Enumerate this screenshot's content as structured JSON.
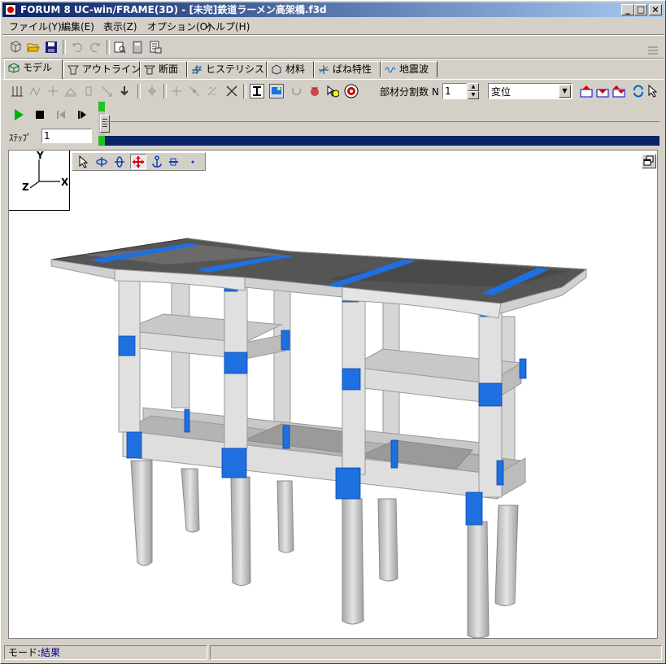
{
  "window": {
    "title": "FORUM 8  UC-win/FRAME(3D) - [未完]鉄道ラーメン高架橋.f3d",
    "controls": [
      "_",
      "□",
      "×"
    ]
  },
  "menu": [
    "ファイル(Y)",
    "編集(E)",
    "表示(Z)",
    "オプション(O)",
    "ヘルプ(H)"
  ],
  "tabs": [
    "モデル",
    "アウトライン",
    "断面",
    "ヒステリシス",
    "材料",
    "ばね特性",
    "地震波"
  ],
  "active_tab": "モデル",
  "toolbar2": {
    "division_label": "部材分割数 N",
    "division_value": "1",
    "display_select": "変位"
  },
  "playback": {
    "step_label": "ｽﾃｯﾌﾟ",
    "step_value": "1"
  },
  "axes": {
    "x": "X",
    "y": "Y",
    "z": "Z"
  },
  "statusbar": {
    "mode_label": "モード:",
    "mode_value": "結果"
  },
  "colors": {
    "title_start": "#0a246a",
    "title_end": "#a6caf0",
    "accent_blue": "#1e6fe0",
    "concrete": "#dcdcdc",
    "deck": "#555555",
    "progress": "#0a246a"
  }
}
